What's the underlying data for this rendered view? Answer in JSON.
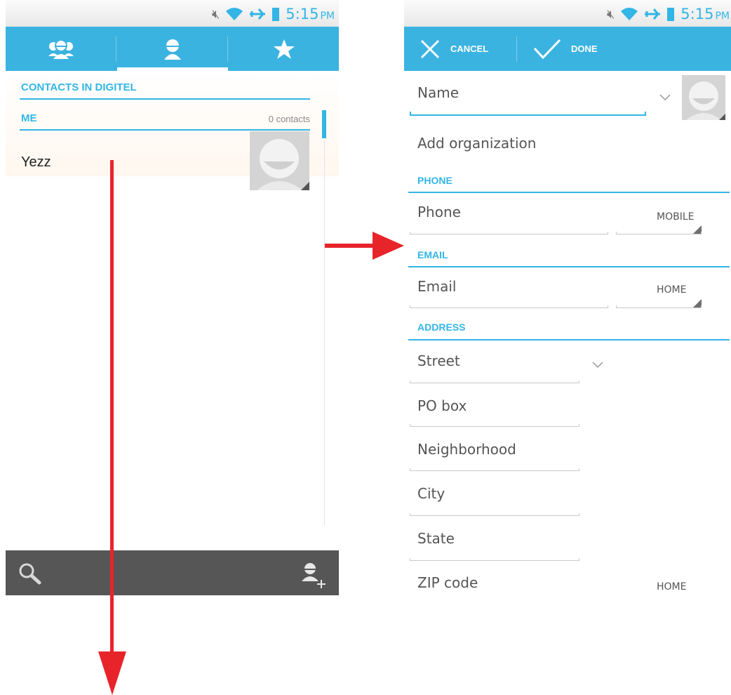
{
  "status": {
    "time": "5:15",
    "ampm": "PM"
  },
  "left": {
    "group_title": "CONTACTS IN DIGITEL",
    "me_header": "ME",
    "me_count": "0 contacts",
    "contact_name": "Yezz",
    "tabs": [
      "groups-icon",
      "person-icon",
      "star-icon"
    ]
  },
  "editor": {
    "cancel_label": "CANCEL",
    "done_label": "DONE",
    "name_placeholder": "Name",
    "organization_label": "Add organization",
    "phone_section": "PHONE",
    "phone_placeholder": "Phone",
    "phone_type": "MOBILE",
    "email_section": "EMAIL",
    "email_placeholder": "Email",
    "email_type": "HOME",
    "address_section": "ADDRESS",
    "street_placeholder": "Street",
    "pobox_placeholder": "PO box",
    "neighborhood_placeholder": "Neighborhood",
    "city_placeholder": "City",
    "state_placeholder": "State",
    "zip_placeholder": "ZIP code",
    "address_type": "HOME"
  },
  "colors": {
    "accent": "#33b5e5",
    "bar": "#3bb3e0",
    "arrow": "#e8242b",
    "bottom_bar": "#565656"
  }
}
